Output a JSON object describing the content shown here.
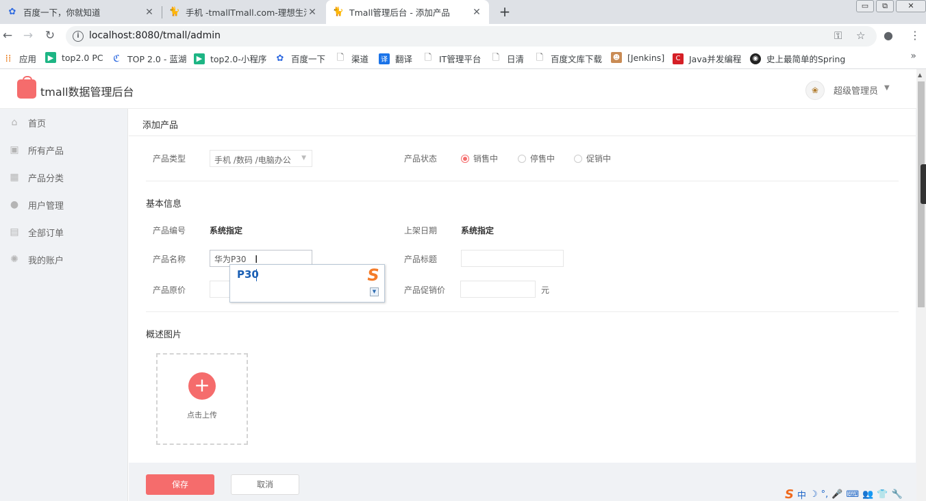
{
  "browser": {
    "tabs": [
      {
        "title": "百度一下，你就知道",
        "close": "✕"
      },
      {
        "title": "手机 -tmallTmall.com-理想生活",
        "close": "✕"
      },
      {
        "title": "Tmall管理后台 - 添加产品",
        "close": "✕"
      }
    ],
    "new_tab": "+",
    "window_buttons": {
      "minimize": "▭",
      "restore": "⧉",
      "close": "✕"
    },
    "url": "localhost:8080/tmall/admin",
    "bookmarks": [
      {
        "label": "应用",
        "color": "#e8710a"
      },
      {
        "label": "top2.0 PC",
        "color": "#1db584"
      },
      {
        "label": "TOP 2.0 - 蓝湖",
        "color": "#2f6ae0"
      },
      {
        "label": "top2.0-小程序",
        "color": "#1db584"
      },
      {
        "label": "百度一下",
        "color": "#2f6ae0"
      },
      {
        "label": "渠道",
        "color": "#777"
      },
      {
        "label": "翻译",
        "color": "#1a73e8"
      },
      {
        "label": "IT管理平台",
        "color": "#777"
      },
      {
        "label": "日清",
        "color": "#777"
      },
      {
        "label": "百度文库下载",
        "color": "#777"
      },
      {
        "label": "[Jenkins]",
        "color": "#c98b54"
      },
      {
        "label": "Java并发编程",
        "color": "#d51f26"
      },
      {
        "label": "史上最简单的Spring",
        "color": "#222"
      }
    ],
    "bookmarks_more": "»"
  },
  "header": {
    "brand": "tmall数据管理后台",
    "user_name": "超级管理员",
    "caret": "▼"
  },
  "sidebar": {
    "items": [
      {
        "label": "首页",
        "icon": "home-icon"
      },
      {
        "label": "所有产品",
        "icon": "box-icon"
      },
      {
        "label": "产品分类",
        "icon": "grid-icon"
      },
      {
        "label": "用户管理",
        "icon": "user-icon"
      },
      {
        "label": "全部订单",
        "icon": "clipboard-icon"
      },
      {
        "label": "我的账户",
        "icon": "gear-icon"
      }
    ]
  },
  "form": {
    "page_title": "添加产品",
    "category_label": "产品类型",
    "category_value": "手机 /数码 /电脑办公",
    "status_label": "产品状态",
    "status_options": [
      "销售中",
      "停售中",
      "促销中"
    ],
    "status_selected": "销售中",
    "basic_section": "基本信息",
    "code_label": "产品编号",
    "code_value": "系统指定",
    "date_label": "上架日期",
    "date_value": "系统指定",
    "name_label": "产品名称",
    "name_value": "华为P30",
    "title_label": "产品标题",
    "title_value": "",
    "price_label": "产品原价",
    "price_value": "",
    "promo_label": "产品促销价",
    "promo_value": "",
    "promo_unit": "元",
    "images_section": "概述图片",
    "upload_label": "点击上传",
    "save_label": "保存",
    "cancel_label": "取消"
  },
  "ime": {
    "composition": "P30",
    "logo": "S",
    "taskbar": [
      "中",
      "☽",
      "°,",
      "🎤",
      "⌨",
      "👥",
      "👕",
      "🔧"
    ]
  }
}
